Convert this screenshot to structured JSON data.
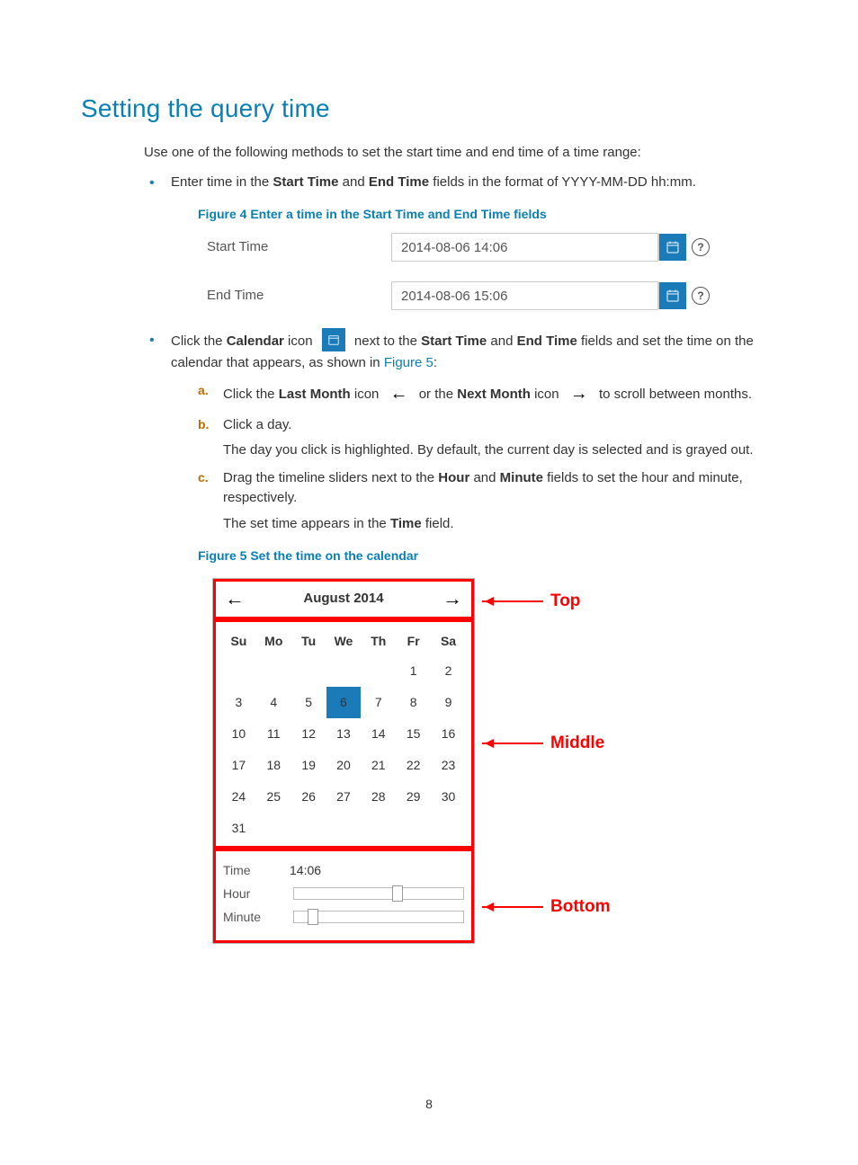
{
  "heading": "Setting the query time",
  "intro": "Use one of the following methods to set the start time and end time of a time range:",
  "bullets": {
    "b1_pre": "Enter time in the ",
    "b1_start": "Start Time",
    "b1_and": " and ",
    "b1_end": "End Time",
    "b1_post": " fields in the format of YYYY-MM-DD hh:mm.",
    "b2_pre": "Click the ",
    "b2_cal": "Calendar",
    "b2_mid1": " icon ",
    "b2_mid2": " next to the ",
    "b2_start": "Start Time",
    "b2_and": " and ",
    "b2_end": "End Time",
    "b2_post1": " fields and set the time on the calendar that appears, as shown in ",
    "b2_figref": "Figure 5",
    "b2_colon": ":"
  },
  "figure4": {
    "caption": "Figure 4 Enter a time in the Start Time and End Time fields",
    "start_label": "Start Time",
    "start_value": "2014-08-06 14:06",
    "end_label": "End Time",
    "end_value": "2014-08-06 15:06"
  },
  "steps": {
    "a_marker": "a.",
    "a_pre": "Click the ",
    "a_last": "Last Month",
    "a_mid1": " icon ",
    "a_mid2": " or the ",
    "a_next": "Next Month",
    "a_mid3": " icon ",
    "a_post": " to scroll between months.",
    "b_marker": "b.",
    "b_text": "Click a day.",
    "b_note": "The day you click is highlighted. By default, the current day is selected and is grayed out.",
    "c_marker": "c.",
    "c_pre": "Drag the timeline sliders next to the ",
    "c_hour": "Hour",
    "c_and": " and ",
    "c_minute": "Minute",
    "c_post": " fields to set the hour and minute, respectively.",
    "c_note_pre": "The set time appears in the ",
    "c_note_time": "Time",
    "c_note_post": " field."
  },
  "figure5": {
    "caption": "Figure 5 Set the time on the calendar",
    "month": "August 2014",
    "dow": [
      "Su",
      "Mo",
      "Tu",
      "We",
      "Th",
      "Fr",
      "Sa"
    ],
    "weeks": [
      [
        "",
        "",
        "",
        "",
        "",
        "1",
        "2"
      ],
      [
        "3",
        "4",
        "5",
        "6",
        "7",
        "8",
        "9"
      ],
      [
        "10",
        "11",
        "12",
        "13",
        "14",
        "15",
        "16"
      ],
      [
        "17",
        "18",
        "19",
        "20",
        "21",
        "22",
        "23"
      ],
      [
        "24",
        "25",
        "26",
        "27",
        "28",
        "29",
        "30"
      ],
      [
        "31",
        "",
        "",
        "",
        "",
        "",
        ""
      ]
    ],
    "selected_day": "6",
    "time_label": "Time",
    "time_value": "14:06",
    "hour_label": "Hour",
    "minute_label": "Minute",
    "annot_top": "Top",
    "annot_middle": "Middle",
    "annot_bottom": "Bottom"
  },
  "page_number": "8"
}
